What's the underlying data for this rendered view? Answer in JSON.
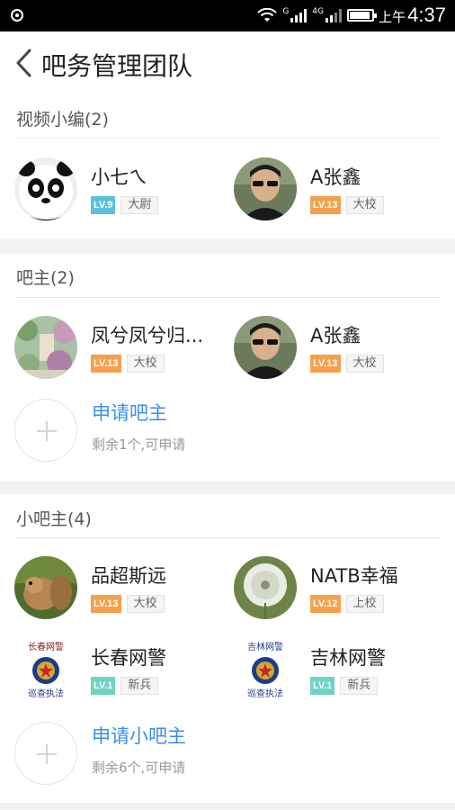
{
  "status_bar": {
    "ampm": "上午",
    "time": "4:37",
    "net_label_1": "G",
    "net_label_2": "4G"
  },
  "header": {
    "title": "吧务管理团队"
  },
  "sections": [
    {
      "title": "视频小编(2)",
      "members": [
        {
          "name": "小七ㄟ",
          "level": "LV.9",
          "level_color": "#5bc0de",
          "rank": "大尉",
          "avatar_icon": "panda-avatar"
        },
        {
          "name": "A张鑫",
          "level": "LV.13",
          "level_color": "#f6a04d",
          "rank": "大校",
          "avatar_icon": "man-sunglasses-avatar"
        }
      ]
    },
    {
      "title": "吧主(2)",
      "members": [
        {
          "name": "凤兮凤兮归...",
          "level": "LV.13",
          "level_color": "#f6a04d",
          "rank": "大校",
          "avatar_icon": "garden-painting-avatar"
        },
        {
          "name": "A张鑫",
          "level": "LV.13",
          "level_color": "#f6a04d",
          "rank": "大校",
          "avatar_icon": "man-sunglasses-avatar"
        }
      ],
      "apply": {
        "label": "申请吧主",
        "sub": "剩余1个,可申请"
      }
    },
    {
      "title": "小吧主(4)",
      "members": [
        {
          "name": "品超斯远",
          "level": "LV.13",
          "level_color": "#f6a04d",
          "rank": "大校",
          "avatar_icon": "squirrel-avatar"
        },
        {
          "name": "NATB幸福",
          "level": "LV.12",
          "level_color": "#f6a04d",
          "rank": "上校",
          "avatar_icon": "dandelion-avatar"
        },
        {
          "name": "长春网警",
          "level": "LV.1",
          "level_color": "#6fd3c2",
          "rank": "新兵",
          "avatar_icon": "police-emblem-avatar",
          "seal_top": "长春网警",
          "seal_bottom": "巡查执法"
        },
        {
          "name": "吉林网警",
          "level": "LV.1",
          "level_color": "#6fd3c2",
          "rank": "新兵",
          "avatar_icon": "police-emblem-avatar",
          "seal_top": "吉林网警",
          "seal_bottom": "巡查执法"
        }
      ],
      "apply": {
        "label": "申请小吧主",
        "sub": "剩余6个,可申请"
      }
    }
  ]
}
